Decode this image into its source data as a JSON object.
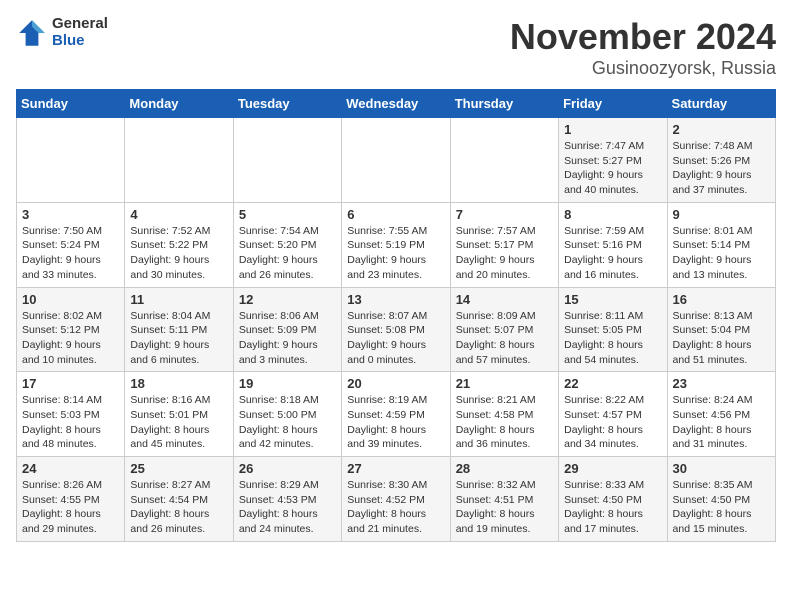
{
  "logo": {
    "general": "General",
    "blue": "Blue"
  },
  "title": "November 2024",
  "location": "Gusinoozyorsk, Russia",
  "days_header": [
    "Sunday",
    "Monday",
    "Tuesday",
    "Wednesday",
    "Thursday",
    "Friday",
    "Saturday"
  ],
  "weeks": [
    [
      {
        "day": "",
        "info": ""
      },
      {
        "day": "",
        "info": ""
      },
      {
        "day": "",
        "info": ""
      },
      {
        "day": "",
        "info": ""
      },
      {
        "day": "",
        "info": ""
      },
      {
        "day": "1",
        "info": "Sunrise: 7:47 AM\nSunset: 5:27 PM\nDaylight: 9 hours\nand 40 minutes."
      },
      {
        "day": "2",
        "info": "Sunrise: 7:48 AM\nSunset: 5:26 PM\nDaylight: 9 hours\nand 37 minutes."
      }
    ],
    [
      {
        "day": "3",
        "info": "Sunrise: 7:50 AM\nSunset: 5:24 PM\nDaylight: 9 hours\nand 33 minutes."
      },
      {
        "day": "4",
        "info": "Sunrise: 7:52 AM\nSunset: 5:22 PM\nDaylight: 9 hours\nand 30 minutes."
      },
      {
        "day": "5",
        "info": "Sunrise: 7:54 AM\nSunset: 5:20 PM\nDaylight: 9 hours\nand 26 minutes."
      },
      {
        "day": "6",
        "info": "Sunrise: 7:55 AM\nSunset: 5:19 PM\nDaylight: 9 hours\nand 23 minutes."
      },
      {
        "day": "7",
        "info": "Sunrise: 7:57 AM\nSunset: 5:17 PM\nDaylight: 9 hours\nand 20 minutes."
      },
      {
        "day": "8",
        "info": "Sunrise: 7:59 AM\nSunset: 5:16 PM\nDaylight: 9 hours\nand 16 minutes."
      },
      {
        "day": "9",
        "info": "Sunrise: 8:01 AM\nSunset: 5:14 PM\nDaylight: 9 hours\nand 13 minutes."
      }
    ],
    [
      {
        "day": "10",
        "info": "Sunrise: 8:02 AM\nSunset: 5:12 PM\nDaylight: 9 hours\nand 10 minutes."
      },
      {
        "day": "11",
        "info": "Sunrise: 8:04 AM\nSunset: 5:11 PM\nDaylight: 9 hours\nand 6 minutes."
      },
      {
        "day": "12",
        "info": "Sunrise: 8:06 AM\nSunset: 5:09 PM\nDaylight: 9 hours\nand 3 minutes."
      },
      {
        "day": "13",
        "info": "Sunrise: 8:07 AM\nSunset: 5:08 PM\nDaylight: 9 hours\nand 0 minutes."
      },
      {
        "day": "14",
        "info": "Sunrise: 8:09 AM\nSunset: 5:07 PM\nDaylight: 8 hours\nand 57 minutes."
      },
      {
        "day": "15",
        "info": "Sunrise: 8:11 AM\nSunset: 5:05 PM\nDaylight: 8 hours\nand 54 minutes."
      },
      {
        "day": "16",
        "info": "Sunrise: 8:13 AM\nSunset: 5:04 PM\nDaylight: 8 hours\nand 51 minutes."
      }
    ],
    [
      {
        "day": "17",
        "info": "Sunrise: 8:14 AM\nSunset: 5:03 PM\nDaylight: 8 hours\nand 48 minutes."
      },
      {
        "day": "18",
        "info": "Sunrise: 8:16 AM\nSunset: 5:01 PM\nDaylight: 8 hours\nand 45 minutes."
      },
      {
        "day": "19",
        "info": "Sunrise: 8:18 AM\nSunset: 5:00 PM\nDaylight: 8 hours\nand 42 minutes."
      },
      {
        "day": "20",
        "info": "Sunrise: 8:19 AM\nSunset: 4:59 PM\nDaylight: 8 hours\nand 39 minutes."
      },
      {
        "day": "21",
        "info": "Sunrise: 8:21 AM\nSunset: 4:58 PM\nDaylight: 8 hours\nand 36 minutes."
      },
      {
        "day": "22",
        "info": "Sunrise: 8:22 AM\nSunset: 4:57 PM\nDaylight: 8 hours\nand 34 minutes."
      },
      {
        "day": "23",
        "info": "Sunrise: 8:24 AM\nSunset: 4:56 PM\nDaylight: 8 hours\nand 31 minutes."
      }
    ],
    [
      {
        "day": "24",
        "info": "Sunrise: 8:26 AM\nSunset: 4:55 PM\nDaylight: 8 hours\nand 29 minutes."
      },
      {
        "day": "25",
        "info": "Sunrise: 8:27 AM\nSunset: 4:54 PM\nDaylight: 8 hours\nand 26 minutes."
      },
      {
        "day": "26",
        "info": "Sunrise: 8:29 AM\nSunset: 4:53 PM\nDaylight: 8 hours\nand 24 minutes."
      },
      {
        "day": "27",
        "info": "Sunrise: 8:30 AM\nSunset: 4:52 PM\nDaylight: 8 hours\nand 21 minutes."
      },
      {
        "day": "28",
        "info": "Sunrise: 8:32 AM\nSunset: 4:51 PM\nDaylight: 8 hours\nand 19 minutes."
      },
      {
        "day": "29",
        "info": "Sunrise: 8:33 AM\nSunset: 4:50 PM\nDaylight: 8 hours\nand 17 minutes."
      },
      {
        "day": "30",
        "info": "Sunrise: 8:35 AM\nSunset: 4:50 PM\nDaylight: 8 hours\nand 15 minutes."
      }
    ]
  ]
}
